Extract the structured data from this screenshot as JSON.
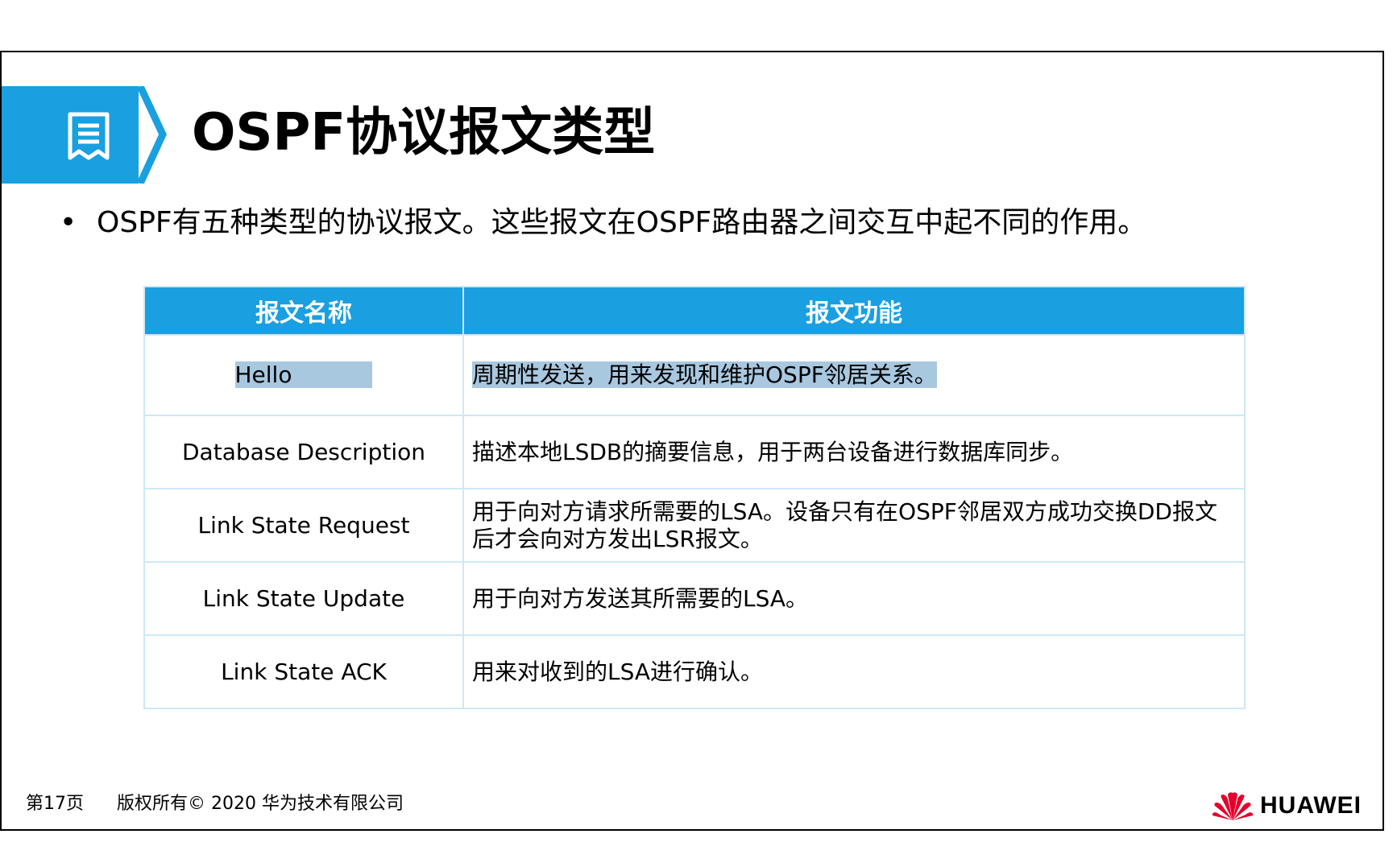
{
  "title": "OSPF协议报文类型",
  "bullet": "OSPF有五种类型的协议报文。这些报文在OSPF路由器之间交互中起不同的作用。",
  "table": {
    "headers": [
      "报文名称",
      "报文功能"
    ],
    "rows": [
      {
        "name": "Hello",
        "function": "周期性发送，用来发现和维护OSPF邻居关系。"
      },
      {
        "name": "Database Description",
        "function": "描述本地LSDB的摘要信息，用于两台设备进行数据库同步。"
      },
      {
        "name": "Link State Request",
        "function": "用于向对方请求所需要的LSA。设备只有在OSPF邻居双方成功交换DD报文后才会向对方发出LSR报文。"
      },
      {
        "name": "Link State Update",
        "function": "用于向对方发送其所需要的LSA。"
      },
      {
        "name": "Link State ACK",
        "function": "用来对收到的LSA进行确认。"
      }
    ]
  },
  "footer": {
    "page": "第17页",
    "copyright": "版权所有© 2020 华为技术有限公司",
    "brand": "HUAWEI"
  },
  "colors": {
    "accent": "#1a9fe0",
    "table_border": "#cde9f5",
    "selection_highlight": "#a8c8e0",
    "logo_red": "#e4002b"
  },
  "icons": {
    "title": "document-icon",
    "logo": "huawei-logo-icon"
  }
}
